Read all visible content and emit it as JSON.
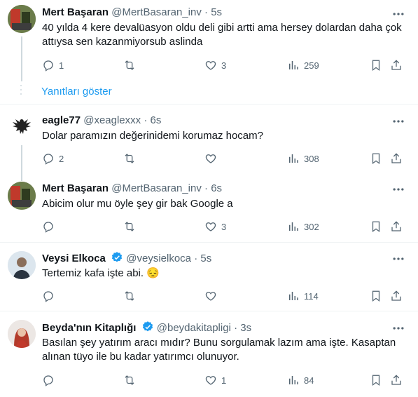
{
  "tweets": [
    {
      "name": "Mert Başaran",
      "handle": "@MertBasaran_inv",
      "time": "5s",
      "text": "40 yılda 4 kere devalüasyon oldu deli gibi artti ama hersey dolardan daha çok attıysa sen kazanmiyorsub aslinda",
      "replies": "1",
      "retweets": "",
      "likes": "3",
      "views": "259"
    },
    {
      "name": "eagle77",
      "handle": "@xeaglexxx",
      "time": "6s",
      "text": "Dolar paramızın değerinidemi korumaz hocam?",
      "replies": "2",
      "retweets": "",
      "likes": "",
      "views": "308"
    },
    {
      "name": "Mert Başaran",
      "handle": "@MertBasaran_inv",
      "time": "6s",
      "text": "Abicim olur mu öyle şey gir bak Google a",
      "replies": "",
      "retweets": "",
      "likes": "3",
      "views": "302"
    },
    {
      "name": "Veysi Elkoca",
      "handle": "@veysielkoca",
      "time": "5s",
      "text": "Tertemiz kafa işte abi.",
      "emoji": "😔",
      "replies": "",
      "retweets": "",
      "likes": "",
      "views": "114"
    },
    {
      "name": "Beyda'nın Kitaplığı",
      "handle": "@beydakitapligi",
      "time": "3s",
      "text": "Basılan şey yatırım aracı mıdır? Bunu sorgulamak lazım ama işte. Kasaptan alınan tüyo ile bu kadar yatırımcı olunuyor.",
      "replies": "",
      "retweets": "",
      "likes": "1",
      "views": "84"
    }
  ],
  "show_replies_label": "Yanıtları göster",
  "dot": "·",
  "colors": {
    "accent": "#1d9bf0",
    "secondary_text": "#536471",
    "separator": "#eff3f4",
    "thread_line": "#cfd9de"
  },
  "icons": [
    "reply-icon",
    "retweet-icon",
    "like-icon",
    "views-icon",
    "bookmark-icon",
    "share-icon",
    "more-icon",
    "verified-badge-icon"
  ]
}
